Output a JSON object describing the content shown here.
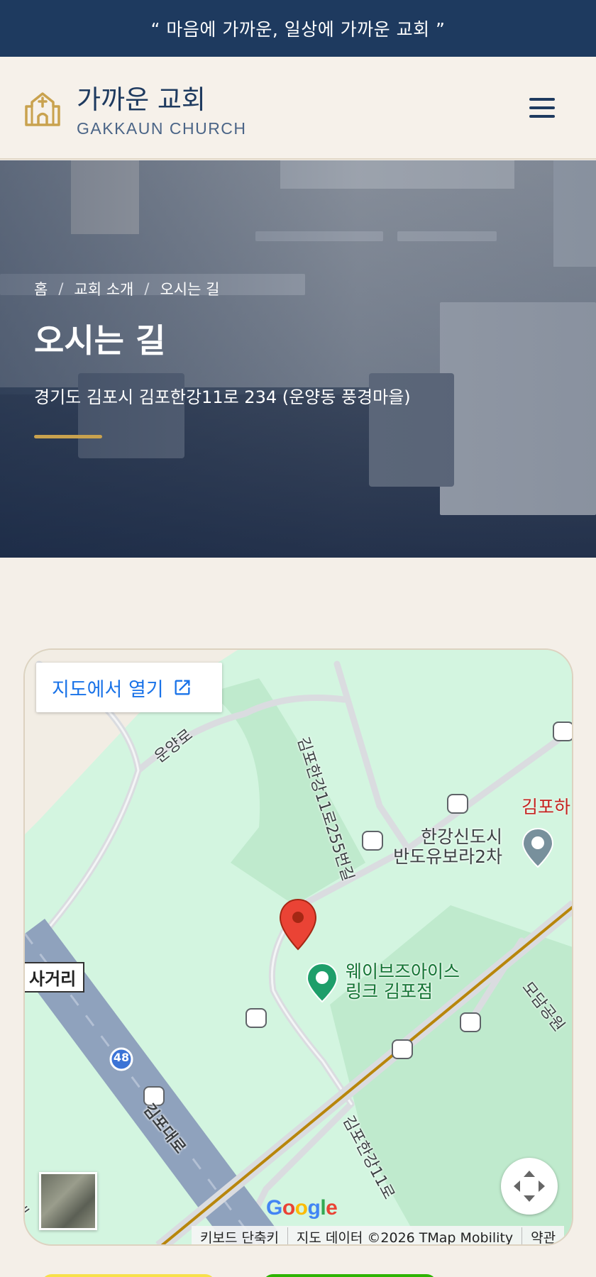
{
  "topbar": {
    "quote": "“ 마음에 가까운, 일상에 가까운 교회 ”"
  },
  "header": {
    "title": "가까운 교회",
    "subtitle": "GAKKAUN CHURCH",
    "logo_icon": "church-icon",
    "menu_icon": "hamburger-menu-icon"
  },
  "hero": {
    "breadcrumb": [
      "홈",
      "교회 소개",
      "오시는 길"
    ],
    "breadcrumb_separator": "/",
    "title": "오시는 길",
    "address": "경기도 김포시 김포한강11로 234 (운양동 풍경마을)",
    "accent_color": "#c9a24e"
  },
  "map": {
    "open_button_label": "지도에서 열기",
    "open_button_icon": "external-link-icon",
    "places": {
      "apartment_line1": "한강신도시",
      "apartment_line2": "반도유보라2차",
      "red_place": "김포하",
      "rink_line1": "웨이브즈아이스",
      "rink_line2": "링크 김포점",
      "junction": "사거리"
    },
    "roads": {
      "unyang": "운양로",
      "hangang255": "김포한강11로255번길",
      "gimpodaero": "김포대로",
      "hangang11": "김포한강11로",
      "modam": "모담공원",
      "route_number": "48",
      "partial_left": "대"
    },
    "google_logo": "Google",
    "attribution": [
      "키보드 단축키",
      "지도 데이터 ©2026 TMap Mobility",
      "약관"
    ],
    "fullscreen_icon": "fullscreen-icon",
    "marker_icon": "map-pin-icon",
    "colors": {
      "land": "#d3f5e0",
      "road": "#dadce0",
      "link": "#1a73e8"
    }
  }
}
